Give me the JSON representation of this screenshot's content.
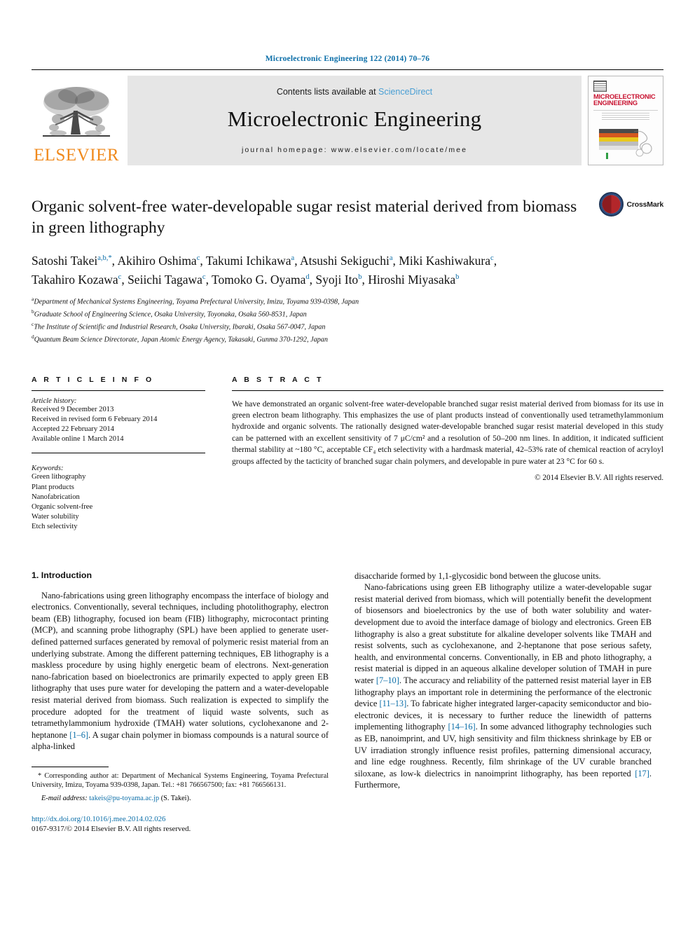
{
  "running_head": "Microelectronic Engineering 122 (2014) 70–76",
  "masthead": {
    "publisher_name": "ELSEVIER",
    "contents_prefix": "Contents lists available at ",
    "contents_link": "ScienceDirect",
    "journal_title": "Microelectronic Engineering",
    "homepage": "journal homepage: www.elsevier.com/locate/mee",
    "cover": {
      "line1": "MICROELECTRONIC",
      "line2": "ENGINEERING"
    }
  },
  "article": {
    "title": "Organic solvent-free water-developable sugar resist material derived from biomass in green lithography",
    "crossmark_label": "CrossMark",
    "authors_line1": [
      {
        "name": "Satoshi Takei",
        "sup": "a,b,",
        "star": "*"
      },
      {
        "name": "Akihiro Oshima",
        "sup": "c"
      },
      {
        "name": "Takumi Ichikawa",
        "sup": "a"
      },
      {
        "name": "Atsushi Sekiguchi",
        "sup": "a"
      },
      {
        "name": "Miki Kashiwakura",
        "sup": "c"
      }
    ],
    "authors_line2": [
      {
        "name": "Takahiro Kozawa",
        "sup": "c"
      },
      {
        "name": "Seiichi Tagawa",
        "sup": "c"
      },
      {
        "name": "Tomoko G. Oyama",
        "sup": "d"
      },
      {
        "name": "Syoji Ito",
        "sup": "b"
      },
      {
        "name": "Hiroshi Miyasaka",
        "sup": "b"
      }
    ],
    "affiliations": [
      {
        "sup": "a",
        "text": "Department of Mechanical Systems Engineering, Toyama Prefectural University, Imizu, Toyama 939-0398, Japan"
      },
      {
        "sup": "b",
        "text": "Graduate School of Engineering Science, Osaka University, Toyonaka, Osaka 560-8531, Japan"
      },
      {
        "sup": "c",
        "text": "The Institute of Scientific and Industrial Research, Osaka University, Ibaraki, Osaka 567-0047, Japan"
      },
      {
        "sup": "d",
        "text": "Quantum Beam Science Directorate, Japan Atomic Energy Agency, Takasaki, Gunma 370-1292, Japan"
      }
    ]
  },
  "article_info": {
    "heading": "A R T I C L E    I N F O",
    "history_label": "Article history:",
    "history": [
      "Received 9 December 2013",
      "Received in revised form 6 February 2014",
      "Accepted 22 February 2014",
      "Available online 1 March 2014"
    ],
    "keywords_label": "Keywords:",
    "keywords": [
      "Green lithography",
      "Plant products",
      "Nanofabrication",
      "Organic solvent-free",
      "Water solubility",
      "Etch selectivity"
    ]
  },
  "abstract": {
    "heading": "A B S T R A C T",
    "body": "We have demonstrated an organic solvent-free water-developable branched sugar resist material derived from biomass for its use in green electron beam lithography. This emphasizes the use of plant products instead of conventionally used tetramethylammonium hydroxide and organic solvents. The rationally designed water-developable branched sugar resist material developed in this study can be patterned with an excellent sensitivity of 7 μC/cm² and a resolution of 50–200 nm lines. In addition, it indicated sufficient thermal stability at ~180 °C, acceptable CF₄ etch selectivity with a hardmask material, 42–53% rate of chemical reaction of acryloyl groups affected by the tacticity of branched sugar chain polymers, and developable in pure water at 23 °C for 60 s.",
    "copyright": "© 2014 Elsevier B.V. All rights reserved."
  },
  "body": {
    "section_heading": "1. Introduction",
    "left_para_1": "Nano-fabrications using green lithography encompass the interface of biology and electronics. Conventionally, several techniques, including photolithography, electron beam (EB) lithography, focused ion beam (FIB) lithography, microcontact printing (MCP), and scanning probe lithography (SPL) have been applied to generate user-defined patterned surfaces generated by removal of polymeric resist material from an underlying substrate. Among the different patterning techniques, EB lithography is a maskless procedure by using highly energetic beam of electrons. Next-generation nano-fabrication based on bioelectronics are primarily expected to apply green EB lithography that uses pure water for developing the pattern and a water-developable resist material derived from biomass. Such realization is expected to simplify the procedure adopted for the treatment of liquid waste solvents, such as tetramethylammonium hydroxide (TMAH) water solutions, cyclohexanone and 2-heptanone ",
    "left_ref_1": "[1–6]",
    "left_para_1_tail": ". A sugar chain polymer in biomass compounds is a natural source of alpha-linked",
    "right_para_0": "disaccharide formed by 1,1-glycosidic bond between the glucose units.",
    "right_para_1_a": "Nano-fabrications using green EB lithography utilize a water-developable sugar resist material derived from biomass, which will potentially benefit the development of biosensors and bioelectronics by the use of both water solubility and water-development due to avoid the interface damage of biology and electronics. Green EB lithography is also a great substitute for alkaline developer solvents like TMAH and resist solvents, such as cyclohexanone, and 2-heptanone that pose serious safety, health, and environmental concerns. Conventionally, in EB and photo lithography, a resist material is dipped in an aqueous alkaline developer solution of TMAH in pure water ",
    "right_ref_1": "[7–10]",
    "right_para_1_b": ". The accuracy and reliability of the patterned resist material layer in EB lithography plays an important role in determining the performance of the electronic device ",
    "right_ref_2": "[11–13]",
    "right_para_1_c": ". To fabricate higher integrated larger-capacity semiconductor and bio-electronic devices, it is necessary to further reduce the linewidth of patterns implementing lithography ",
    "right_ref_3": "[14–16]",
    "right_para_1_d": ". In some advanced lithography technologies such as EB, nanoimprint, and UV, high sensitivity and film thickness shrinkage by EB or UV irradiation strongly influence resist profiles, patterning dimensional accuracy, and line edge roughness. Recently, film shrinkage of the UV curable branched siloxane, as low-k dielectrics in nanoimprint lithography, has been reported ",
    "right_ref_4": "[17]",
    "right_para_1_e": ". Furthermore,"
  },
  "footer": {
    "corresponding_marker": "*",
    "corresponding_text": "Corresponding author at: Department of Mechanical Systems Engineering, Toyama Prefectural University, Imizu, Toyama 939-0398, Japan. Tel.: +81 766567500; fax: +81 766566131.",
    "email_label": "E-mail address:",
    "email": "takeis@pu-toyama.ac.jp",
    "email_owner": "(S. Takei).",
    "doi": "http://dx.doi.org/10.1016/j.mee.2014.02.026",
    "issn": "0167-9317/© 2014 Elsevier B.V. All rights reserved."
  },
  "colors": {
    "link": "#0b6ea8",
    "elsevier_orange": "#f08a1d",
    "band_gray": "#e6e6e6",
    "cover_red": "#c8102e"
  }
}
